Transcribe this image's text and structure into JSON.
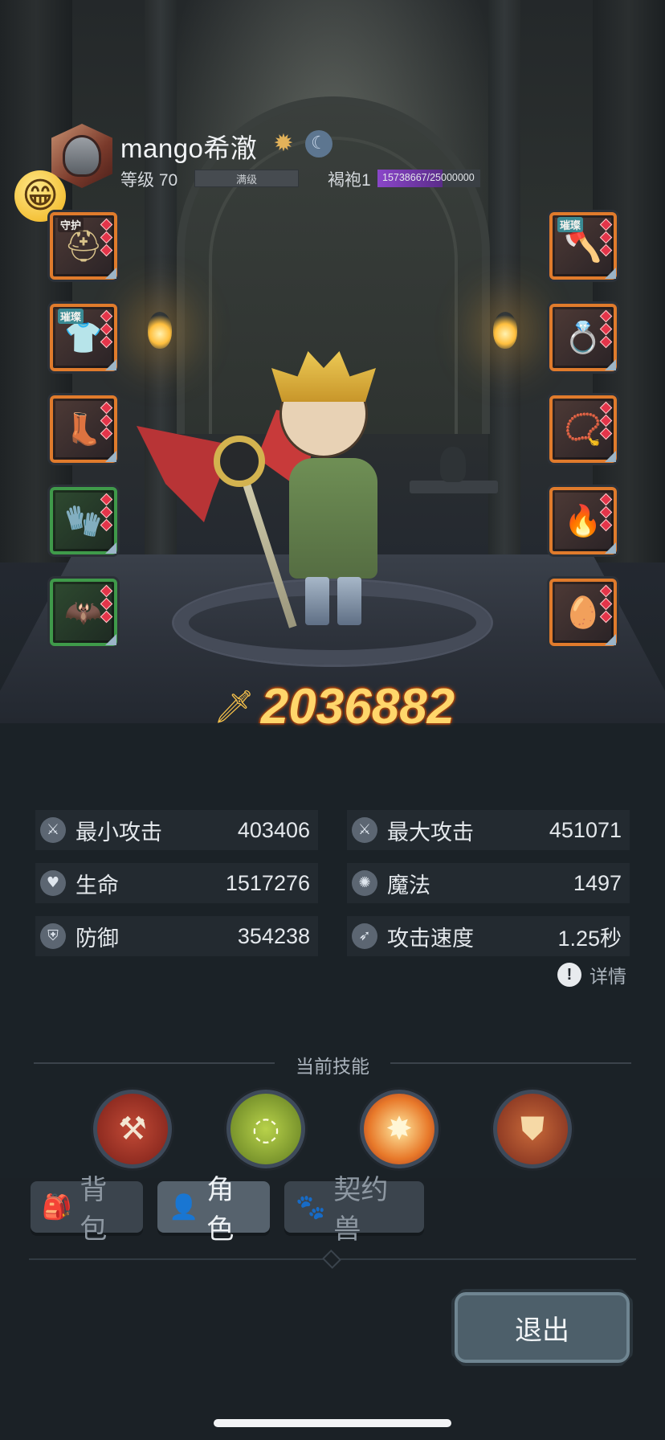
{
  "player": {
    "name": "mango希澈",
    "level_label": "等级 70",
    "level_bar_text": "满级",
    "rank_label": "褐袍1",
    "rank_progress_text": "15738667/25000000",
    "rank_progress_fraction": 0.63
  },
  "equipment": {
    "left": [
      {
        "tag": "守护",
        "icon": "helmet-icon",
        "glyph": "⛑",
        "frame": "orange"
      },
      {
        "tag": "璀璨",
        "icon": "armor-icon",
        "glyph": "👕",
        "frame": "orange"
      },
      {
        "tag": "",
        "icon": "boots-icon",
        "glyph": "👢",
        "frame": "orange"
      },
      {
        "tag": "",
        "icon": "gauntlet-icon",
        "glyph": "🧤",
        "frame": "green"
      },
      {
        "tag": "",
        "icon": "shoulder-icon",
        "glyph": "🦇",
        "frame": "green"
      }
    ],
    "right": [
      {
        "tag": "璀璨",
        "icon": "axe-weapon-icon",
        "glyph": "🪓",
        "frame": "orange"
      },
      {
        "tag": "",
        "icon": "ring-icon",
        "glyph": "💍",
        "frame": "orange"
      },
      {
        "tag": "",
        "icon": "necklace-icon",
        "glyph": "📿",
        "frame": "orange"
      },
      {
        "tag": "",
        "icon": "flame-charm-icon",
        "glyph": "🔥",
        "frame": "orange"
      },
      {
        "tag": "",
        "icon": "pet-egg-icon",
        "glyph": "🥚",
        "frame": "orange"
      }
    ]
  },
  "power": {
    "icon": "sword-power-icon",
    "value": "2036882"
  },
  "stats": [
    {
      "label": "最小攻击",
      "value": "403406",
      "icon": "sword-icon",
      "glyph": "⚔"
    },
    {
      "label": "最大攻击",
      "value": "451071",
      "icon": "sword-icon",
      "glyph": "⚔"
    },
    {
      "label": "生命",
      "value": "1517276",
      "icon": "heart-icon",
      "glyph": "♥"
    },
    {
      "label": "魔法",
      "value": "1497",
      "icon": "magic-swirl-icon",
      "glyph": "✺"
    },
    {
      "label": "防御",
      "value": "354238",
      "icon": "shield-icon",
      "glyph": "⛨"
    },
    {
      "label": "攻击速度",
      "value": "1.25秒",
      "icon": "speed-icon",
      "glyph": "➶"
    }
  ],
  "details_label": "详情",
  "skills": {
    "title": "当前技能",
    "items": [
      {
        "icon": "crossed-axes-icon",
        "glyph": "⚒"
      },
      {
        "icon": "poison-bubbles-icon",
        "glyph": "◌"
      },
      {
        "icon": "explosion-icon",
        "glyph": "✸"
      },
      {
        "icon": "guard-shield-icon",
        "glyph": "⛊"
      }
    ]
  },
  "tabs": [
    {
      "label": "背包",
      "icon": "bag-icon",
      "glyph": "🎒",
      "active": false
    },
    {
      "label": "角色",
      "icon": "character-icon",
      "glyph": "👤",
      "active": true
    },
    {
      "label": "契约兽",
      "icon": "paw-icon",
      "glyph": "🐾",
      "active": false
    }
  ],
  "exit_label": "退出",
  "colors": {
    "power_text": "#ffd66b",
    "rank_fill": "#8a46c9",
    "slot_orange": "#e07b2c",
    "slot_green": "#3f9a4a"
  }
}
